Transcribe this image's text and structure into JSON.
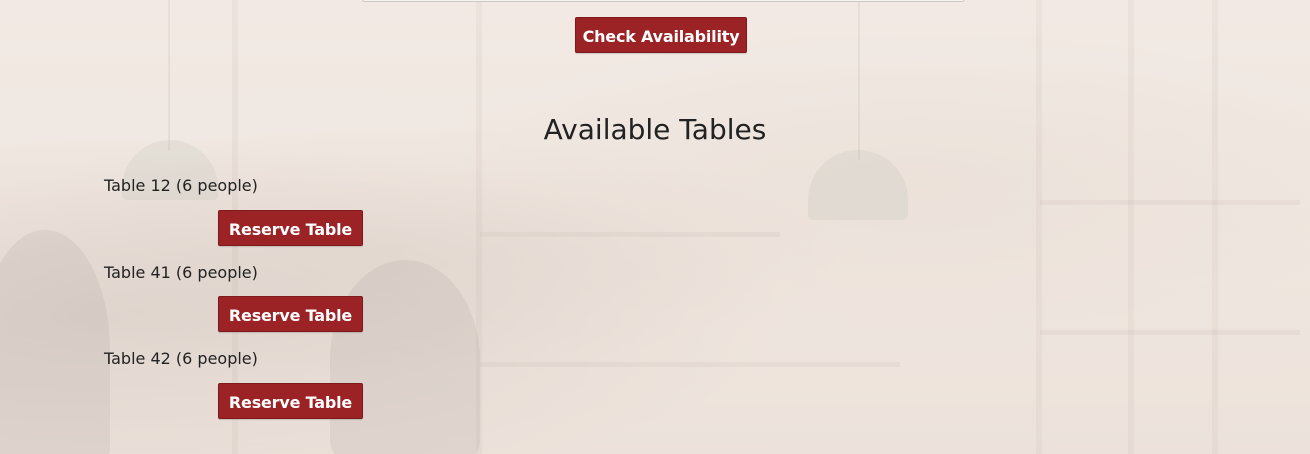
{
  "availability": {
    "check_button": "Check Availability"
  },
  "tables_section": {
    "title": "Available Tables",
    "tables": [
      {
        "label": "Table 12 (6 people)",
        "button": "Reserve Table"
      },
      {
        "label": "Table 41 (6 people)",
        "button": "Reserve Table"
      },
      {
        "label": "Table 42 (6 people)",
        "button": "Reserve Table"
      }
    ]
  },
  "colors": {
    "primary_button": "#9b2225",
    "button_text": "#ffffff",
    "background": "#efe6df",
    "text": "#222222"
  }
}
